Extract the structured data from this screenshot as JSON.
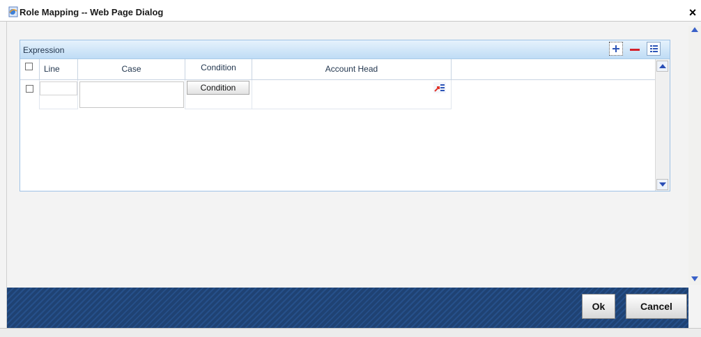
{
  "window": {
    "title": "Role Mapping -- Web Page Dialog",
    "close_label": "×"
  },
  "panel": {
    "title": "Expression",
    "tools": [
      "add-row-icon",
      "delete-row-icon",
      "single-view-icon"
    ]
  },
  "grid": {
    "columns": {
      "line": "Line",
      "case": "Case",
      "condition": "Condition",
      "account_head": "Account Head"
    },
    "rows": [
      {
        "line": "",
        "case": "",
        "condition_button": "Condition",
        "account_head": ""
      }
    ]
  },
  "footer": {
    "ok_label": "Ok",
    "cancel_label": "Cancel"
  },
  "colors": {
    "panel_header": "#bfdcf5",
    "footer": "#23497c",
    "delete_red": "#d4202a",
    "icon_blue": "#2d55b7"
  }
}
